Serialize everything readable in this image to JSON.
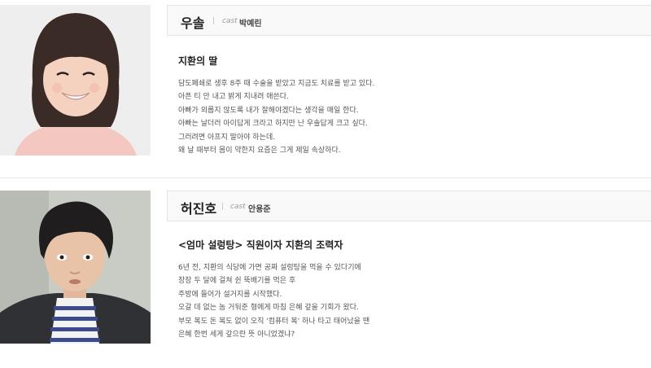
{
  "characters": [
    {
      "name": "우솔",
      "separator": "|",
      "cast_label": "cast",
      "actor": "박예린",
      "role": "지환의 딸",
      "description": [
        "담도폐쇄로 생후 8주 때 수술을 받았고 지금도 치료를 받고 있다.",
        "아픈 티 안 내고 밝게 지내려 애쓴다.",
        "아빠가 외롭지 않도록 내가 잘해야겠다는 생각을 매일 한다.",
        "아빠는 날더러 아이답게 크라고 하지만 난 우솔답게 크고 싶다.",
        "그러려면 아프지 말아야 하는데.",
        "왜 날 때부터 몸이 약한지 요즘은 그게 제일 속상하다."
      ]
    },
    {
      "name": "허진호",
      "separator": "|",
      "cast_label": "cast",
      "actor": "안용준",
      "role": "<엄마 설렁탕> 직원이자 지환의 조력자",
      "description": [
        "6년 전, 지환의 식당에 가면 공짜 설렁탕을 먹을 수 있다기에",
        "장장 두 달에 걸쳐 쉰 뚝배기를 먹은 후",
        "주방에 들어가 설거지를 시작했다.",
        "오갈 데 없는 놈 거둬준 형에게 마침 은혜 갚을 기회가 왔다.",
        "부모 복도 돈 복도 없이 오직 '컴퓨터 복' 하나 타고 태어났을 땐",
        "은혜 한번 세게 갚으란 뜻 아니었겠냐?"
      ]
    }
  ]
}
